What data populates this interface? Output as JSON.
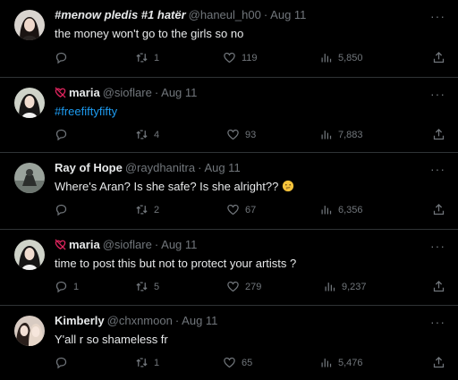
{
  "tweets": [
    {
      "name": "#menow pledis #1 hatër",
      "handle": "@haneul_h00",
      "time": "Aug 11",
      "text": "the money won't go to the girls so no",
      "replies": "",
      "retweets": "1",
      "likes": "119",
      "views": "5,850"
    },
    {
      "name": "maria",
      "handle": "@sioflare",
      "time": "Aug 11",
      "text": "#freefiftyfifty",
      "replies": "",
      "retweets": "4",
      "likes": "93",
      "views": "7,883"
    },
    {
      "name": "Ray of Hope",
      "handle": "@raydhanitra",
      "time": "Aug 11",
      "text": "Where's Aran? Is she safe? Is she alright??",
      "replies": "",
      "retweets": "2",
      "likes": "67",
      "views": "6,356"
    },
    {
      "name": "maria",
      "handle": "@sioflare",
      "time": "Aug 11",
      "text": "time to post this but not to protect your artists ?",
      "replies": "1",
      "retweets": "5",
      "likes": "279",
      "views": "9,237"
    },
    {
      "name": "Kimberly",
      "handle": "@chxnmoon",
      "time": "Aug 11",
      "text": "Y'all r so shameless fr",
      "replies": "",
      "retweets": "1",
      "likes": "65",
      "views": "5,476"
    }
  ],
  "ui": {
    "dot": "·",
    "more": "···"
  }
}
